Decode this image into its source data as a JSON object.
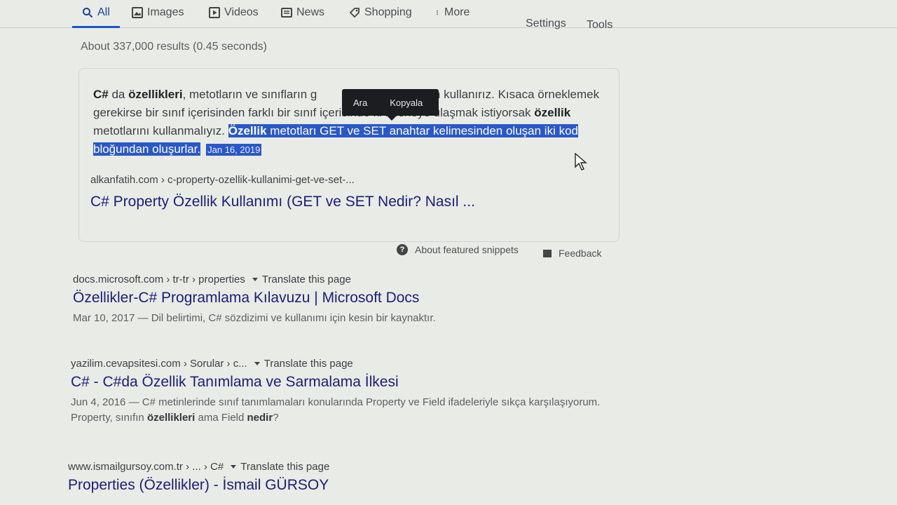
{
  "nav": {
    "tabs": [
      {
        "label": "All",
        "icon": "search-icon"
      },
      {
        "label": "Images",
        "icon": "image-icon"
      },
      {
        "label": "Videos",
        "icon": "video-icon"
      },
      {
        "label": "News",
        "icon": "news-icon"
      },
      {
        "label": "Shopping",
        "icon": "tag-icon"
      },
      {
        "label": "More",
        "icon": "more-vert-icon"
      }
    ],
    "settings": "Settings",
    "tools": "Tools"
  },
  "result_stats": "About 337,000 results (0.45 seconds)",
  "snippet": {
    "text_b1": "C#",
    "text_1": " da ",
    "text_b2": "özellikleri",
    "text_2": ", metotların ve sınıfların g",
    "text_3": "netmek için kullanırız. Kısaca örneklemek gerekirse bir sınıf içerisinden farklı bir sınıf içerisinde ki nesneye ulaşmak istiyorsak ",
    "text_b3": "özellik",
    "text_4": " metotlarını kullanmalıyız. ",
    "sel_b": "Özellik",
    "sel_text": " metotları GET ve SET anahtar kelimesinden oluşan iki kod bloğundan oluşurlar.",
    "date": "Jan 16, 2019",
    "cite": "alkanfatih.com › c-property-ozellik-kullanimi-get-ve-set-...",
    "title": "C# Property Özellik Kullanımı (GET ve SET Nedir? Nasıl ..."
  },
  "popup": {
    "search": "Ara",
    "copy": "Kopyala"
  },
  "snippet_footer": {
    "about": "About featured snippets",
    "feedback": "Feedback"
  },
  "results": [
    {
      "cite": "docs.microsoft.com › tr-tr › properties",
      "translate": "Translate this page",
      "title": "Özellikler-C# Programlama Kılavuzu | Microsoft Docs",
      "desc": "Mar 10, 2017 — Dil belirtimi, C# sözdizimi ve kullanımı için kesin bir kaynaktır."
    },
    {
      "cite": "yazilim.cevapsitesi.com › Sorular › c...",
      "translate": "Translate this page",
      "title": "C# - C#da Özellik Tanımlama ve Sarmalama İlkesi",
      "desc_1": "Jun 4, 2016 — C# metinlerinde sınıf tanımlamaları konularında Property ve Field ifadeleriyle sıkça karşılaşıyorum. Property, sınıfın ",
      "desc_b1": "özellikleri",
      "desc_2": " ama Field ",
      "desc_b2": "nedir",
      "desc_3": "?"
    },
    {
      "cite": "www.ismailgursoy.com.tr › ... › C#",
      "translate": "Translate this page",
      "title": "Properties (Özellikler) - İsmail GÜRSOY"
    }
  ]
}
